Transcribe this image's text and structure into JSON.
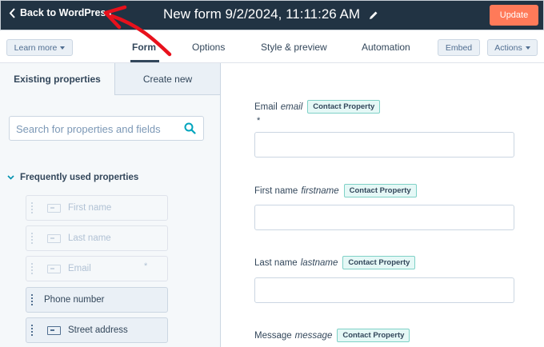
{
  "header": {
    "back_label": "Back to WordPress",
    "form_title": "New form 9/2/2024, 11:11:26 AM",
    "update_label": "Update"
  },
  "toolbar": {
    "learn_more_label": "Learn more",
    "tabs": [
      {
        "label": "Form",
        "active": true
      },
      {
        "label": "Options",
        "active": false
      },
      {
        "label": "Style & preview",
        "active": false
      },
      {
        "label": "Automation",
        "active": false
      }
    ],
    "embed_label": "Embed",
    "actions_label": "Actions"
  },
  "sidebar": {
    "tabs": [
      {
        "label": "Existing properties",
        "active": true
      },
      {
        "label": "Create new",
        "active": false
      }
    ],
    "search": {
      "placeholder": "Search for properties and fields",
      "value": ""
    },
    "section_title": "Frequently used properties",
    "properties": [
      {
        "label": "First name",
        "state": "disabled",
        "required": false
      },
      {
        "label": "Last name",
        "state": "disabled",
        "required": false
      },
      {
        "label": "Email",
        "state": "disabled",
        "required": true
      },
      {
        "label": "Phone number",
        "state": "enabled",
        "required": false
      },
      {
        "label": "Street address",
        "state": "enabled",
        "required": false
      }
    ]
  },
  "form_fields": [
    {
      "label": "Email",
      "internal_name": "email",
      "badge": "Contact Property",
      "required_mark": "*"
    },
    {
      "label": "First name",
      "internal_name": "firstname",
      "badge": "Contact Property"
    },
    {
      "label": "Last name",
      "internal_name": "lastname",
      "badge": "Contact Property"
    },
    {
      "label": "Message",
      "internal_name": "message",
      "badge": "Contact Property"
    }
  ],
  "colors": {
    "header_bg": "#213343",
    "accent_orange": "#ff7a59",
    "annotation_red": "#e8111c",
    "badge_bg": "#e5f8f6",
    "badge_border": "#7fd1c7"
  },
  "icons": {
    "back": "chevron-left-icon",
    "edit": "pencil-icon",
    "search": "search-icon",
    "section": "chevron-down-icon",
    "drag": "drag-handle-icon",
    "field": "text-field-icon"
  }
}
